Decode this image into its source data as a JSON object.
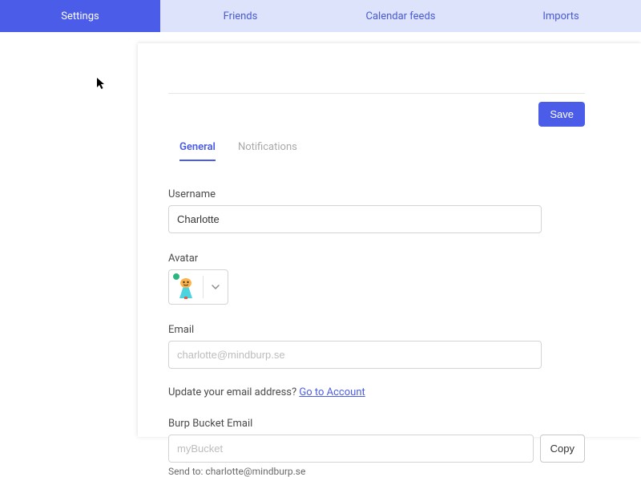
{
  "topnav": {
    "items": [
      {
        "label": "Settings",
        "active": true
      },
      {
        "label": "Friends",
        "active": false
      },
      {
        "label": "Calendar feeds",
        "active": false
      },
      {
        "label": "Imports",
        "active": false
      }
    ]
  },
  "actions": {
    "save_label": "Save",
    "copy_label": "Copy"
  },
  "subtabs": [
    {
      "label": "General",
      "active": true
    },
    {
      "label": "Notifications",
      "active": false
    }
  ],
  "form": {
    "username": {
      "label": "Username",
      "value": "Charlotte"
    },
    "avatar": {
      "label": "Avatar"
    },
    "email": {
      "label": "Email",
      "value": "",
      "placeholder": "charlotte@mindburp.se"
    },
    "email_hint_prefix": "Update your email address? ",
    "email_hint_link": "Go to Account",
    "bucket": {
      "label": "Burp Bucket Email",
      "value": "",
      "placeholder": "myBucket"
    },
    "sendto_prefix": "Send to: ",
    "sendto_value": "charlotte@mindburp.se"
  }
}
